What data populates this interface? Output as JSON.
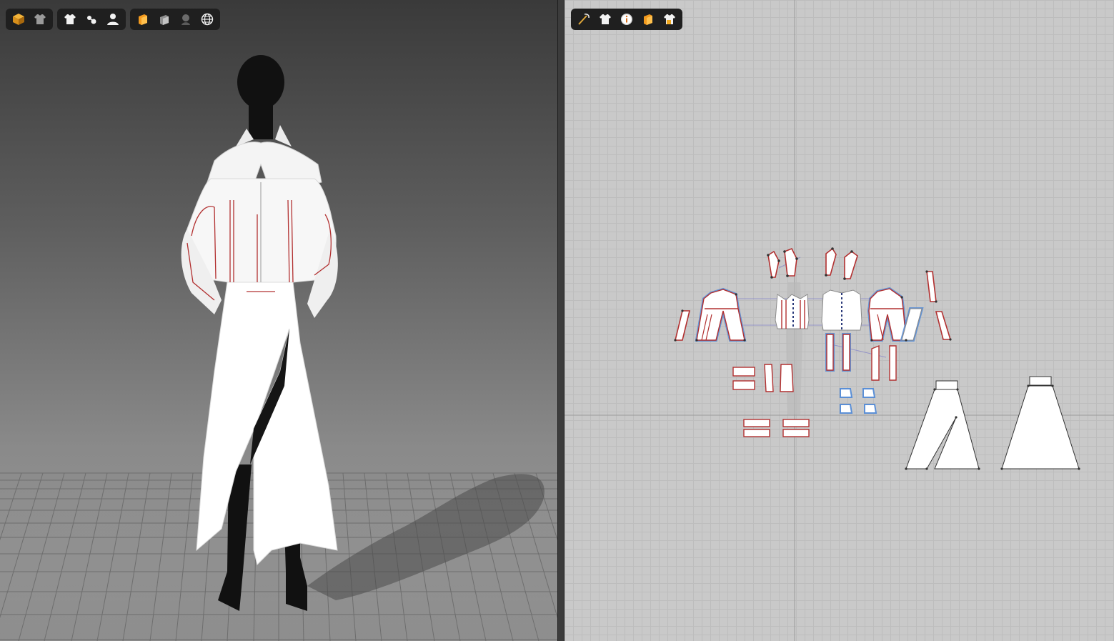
{
  "viewport3d": {
    "toolbars": [
      {
        "items": [
          "cube-display-icon",
          "garment-display-icon"
        ]
      },
      {
        "items": [
          "shirt-icon",
          "shirt-sewing-icon",
          "avatar-icon"
        ]
      },
      {
        "items": [
          "texture-render-icon",
          "fabric-eraser-icon",
          "avatar-shade-icon",
          "globe-icon"
        ]
      }
    ]
  },
  "viewport2d": {
    "toolbars": [
      {
        "items": [
          "segment-tool-icon",
          "pattern-shirt-icon",
          "info-icon",
          "texture-2d-icon",
          "lock-shirt-icon"
        ]
      }
    ]
  },
  "colors": {
    "toolbar_bg": "#1f1f1f",
    "pattern_fill": "#ffffff",
    "seam_red": "#b23030",
    "select_blue": "#5b8fd6",
    "grid_line": "#bdbdbd"
  }
}
